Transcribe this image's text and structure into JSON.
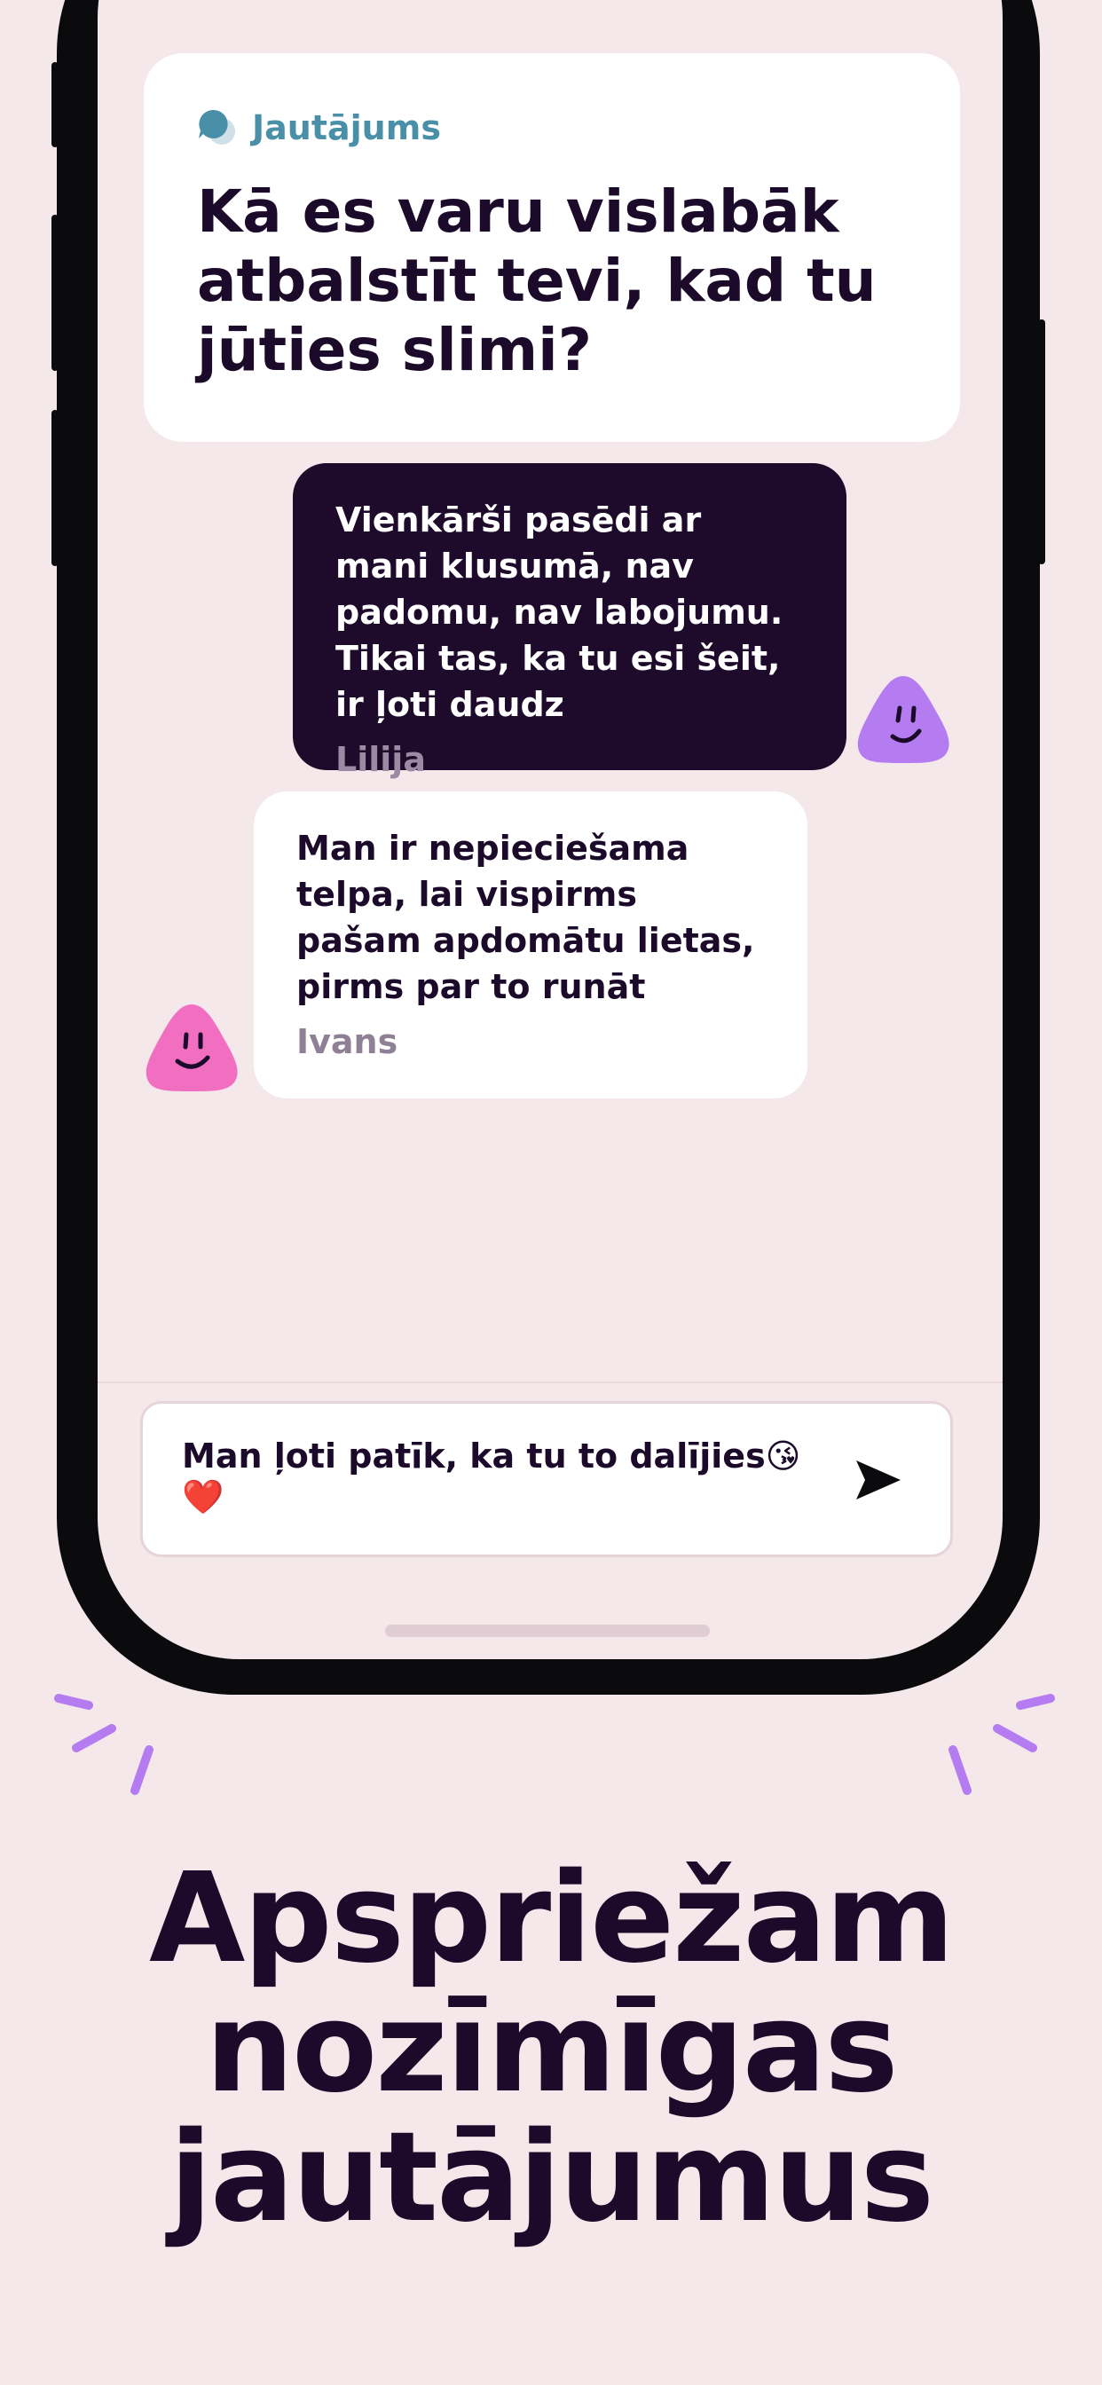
{
  "question_card": {
    "label": "Jautājums",
    "text": "Kā es varu vislabāk atbalstīt tevi, kad tu jūties slimi?"
  },
  "messages": [
    {
      "text": "Vienkārši pasēdi ar mani klusumā, nav padomu, nav labojumu. Tikai tas, ka tu esi šeit, ir ļoti daudz",
      "author": "Lilija"
    },
    {
      "text": "Man ir nepieciešama telpa, lai vispirms pašam apdomātu lietas, pirms par to runāt",
      "author": "Ivans"
    }
  ],
  "composer": {
    "value": "Man ļoti patīk, ka tu to dalījies😘❤️"
  },
  "headline": "Apspriežam nozīmīgas jautājumus",
  "colors": {
    "background": "#f4e8eb",
    "dark_bubble": "#1e0a2a",
    "accent_label": "#4a8fa8",
    "purple_avatar": "#b47cf0",
    "pink_avatar": "#f26ec0"
  },
  "icons": [
    "speech-bubbles-icon",
    "send-icon",
    "purple-smiley-avatar",
    "pink-smiley-avatar",
    "sparkle-icon"
  ]
}
